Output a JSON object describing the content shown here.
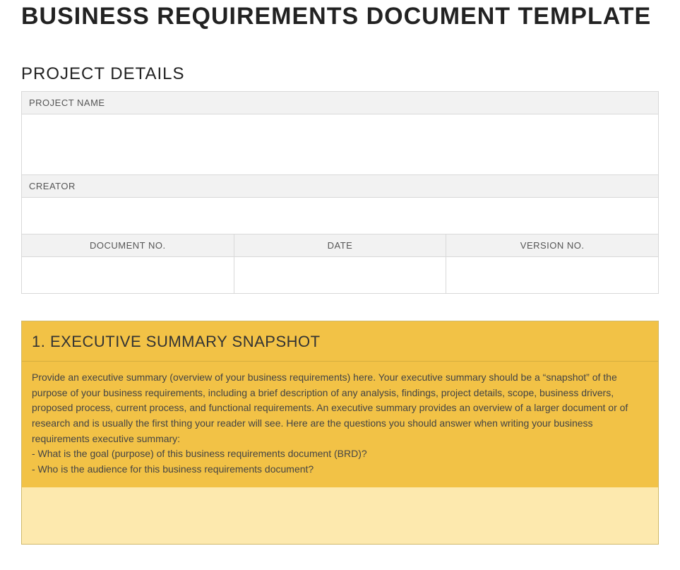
{
  "doc_title": "BUSINESS REQUIREMENTS DOCUMENT TEMPLATE",
  "project_details": {
    "heading": "PROJECT DETAILS",
    "project_name_label": "PROJECT NAME",
    "project_name_value": "",
    "creator_label": "CREATOR",
    "creator_value": "",
    "document_no_label": "DOCUMENT NO.",
    "document_no_value": "",
    "date_label": "DATE",
    "date_value": "",
    "version_no_label": "VERSION NO.",
    "version_no_value": ""
  },
  "exec_summary": {
    "heading": "1. EXECUTIVE SUMMARY SNAPSHOT",
    "body": "Provide an executive summary (overview of your business requirements) here. Your executive summary should be a “snapshot” of the purpose of your business requirements, including a brief description of any analysis, findings, project details, scope, business drivers, proposed process, current process, and functional requirements. An executive summary provides an overview of a larger document or of research and is usually the first thing your reader will see. Here are the questions you should answer when writing your business requirements executive summary:",
    "q1": "- What is the goal (purpose) of this business requirements document (BRD)?",
    "q2": "- Who is the audience for this business requirements document?"
  }
}
